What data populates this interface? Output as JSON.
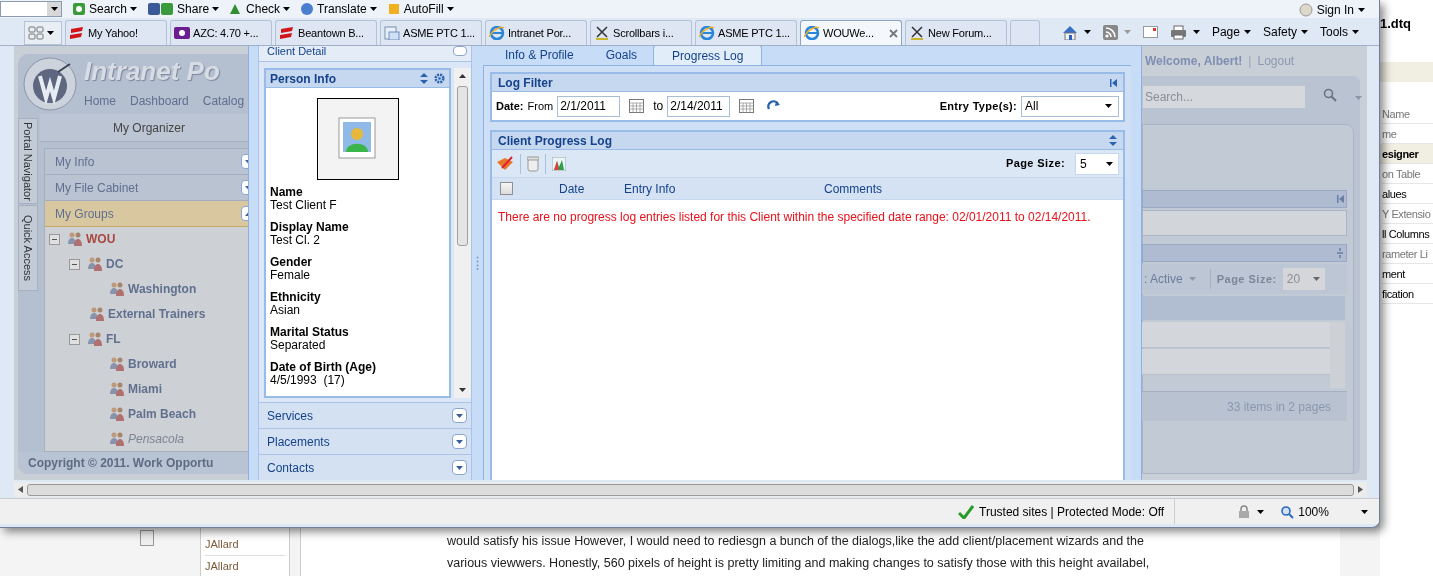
{
  "browser": {
    "toolbar": [
      {
        "label": "Search",
        "kind": "search"
      },
      {
        "label": "Share",
        "kind": "share"
      },
      {
        "label": "Check",
        "kind": "check"
      },
      {
        "label": "Translate",
        "kind": "translate"
      },
      {
        "label": "AutoFill",
        "kind": "autofill"
      }
    ],
    "sign_in": "Sign In",
    "tabs": [
      {
        "label": "My Yahoo!",
        "kind": "espn",
        "selected": false
      },
      {
        "label": "AZC: 4.70 +...",
        "kind": "yahoo",
        "selected": false
      },
      {
        "label": "Beantown B...",
        "kind": "espn",
        "selected": false
      },
      {
        "label": "ASME PTC 1...",
        "kind": "page",
        "selected": false
      },
      {
        "label": "Intranet Por...",
        "kind": "ie",
        "selected": false
      },
      {
        "label": "Scrollbars i...",
        "kind": "forum",
        "selected": false
      },
      {
        "label": "ASME PTC 1...",
        "kind": "ie",
        "selected": false
      },
      {
        "label": "WOUWe...",
        "kind": "ie",
        "selected": true
      },
      {
        "label": "New Forum...",
        "kind": "forum",
        "selected": false
      }
    ],
    "command_bar": [
      "Page",
      "Safety",
      "Tools"
    ],
    "status": {
      "zone": "Trusted sites | Protected Mode: Off",
      "zoom": "100%"
    }
  },
  "page": {
    "logo_title": "Intranet Po",
    "nav": [
      "Home",
      "Dashboard",
      "Catalog"
    ],
    "side_tabs": [
      "Portal Navigator",
      "Quick Access"
    ],
    "organizer_title": "My Organizer",
    "accordion": [
      {
        "label": "My Info",
        "expanded": false
      },
      {
        "label": "My File Cabinet",
        "expanded": false
      },
      {
        "label": "My Groups",
        "expanded": true
      }
    ],
    "tree": [
      {
        "label": "WOU",
        "selected": true,
        "disabled": false,
        "children": [
          {
            "label": "DC",
            "selected": false,
            "disabled": false,
            "children": [
              {
                "label": "Washington",
                "selected": false,
                "disabled": false
              }
            ]
          },
          {
            "label": "External Trainers",
            "selected": false,
            "disabled": false
          },
          {
            "label": "FL",
            "selected": false,
            "disabled": false,
            "children": [
              {
                "label": "Broward",
                "selected": false,
                "disabled": false
              },
              {
                "label": "Miami",
                "selected": false,
                "disabled": false
              },
              {
                "label": "Palm Beach",
                "selected": false,
                "disabled": false
              },
              {
                "label": "Pensacola",
                "selected": false,
                "disabled": true
              }
            ]
          }
        ]
      }
    ],
    "copyright": "Copyright © 2011. Work Opportu",
    "welcome": "Welcome, Albert!",
    "separator": "|",
    "logout": "Logout",
    "search": {
      "placeholder": "Search..."
    },
    "grid": {
      "filter": ": Active",
      "page_size_label": "Page Size:",
      "page_size": "20",
      "pager": "33 items in 2 pages"
    }
  },
  "dialog": {
    "header": "Client Detail",
    "person_info": {
      "title": "Person Info",
      "fields": [
        {
          "label": "Name",
          "value": "Test Client F"
        },
        {
          "label": "Display Name",
          "value": "Test Cl. 2"
        },
        {
          "label": "Gender",
          "value": "Female"
        },
        {
          "label": "Ethnicity",
          "value": "Asian"
        },
        {
          "label": "Marital Status",
          "value": "Separated"
        },
        {
          "label": "Date of Birth (Age)",
          "value": "4/5/1993  (17)"
        }
      ]
    },
    "sections": [
      {
        "label": "Services",
        "expanded": false
      },
      {
        "label": "Placements",
        "expanded": false
      },
      {
        "label": "Contacts",
        "expanded": false
      }
    ],
    "tabs": [
      {
        "label": "Info & Profile",
        "selected": false
      },
      {
        "label": "Goals",
        "selected": false
      },
      {
        "label": "Progress Log",
        "selected": true
      }
    ],
    "log_filter": {
      "title": "Log Filter",
      "date_label": "Date:",
      "from_label": "From",
      "from": "2/1/2011",
      "to_label": "to",
      "to": "2/14/2011",
      "entry_type_label": "Entry Type(s):",
      "entry_type": "All"
    },
    "progress_log": {
      "title": "Client Progress Log",
      "page_size_label": "Page Size:",
      "page_size": "5",
      "select_all": {
        "checked": false
      },
      "columns": [
        "Date",
        "Entry Info",
        "Comments"
      ],
      "empty_message": "There are no progress log entries listed for this Client within the specified date range: 02/01/2011 to 02/14/2011."
    }
  },
  "background": {
    "file": "1.dtq",
    "list": [
      {
        "label": "Name",
        "kind": "item",
        "disabled": true
      },
      {
        "label": "me",
        "kind": "item",
        "disabled": true
      },
      {
        "label": "esigner",
        "kind": "header",
        "disabled": false
      },
      {
        "label": "on Table",
        "kind": "item",
        "disabled": true
      },
      {
        "label": "alues",
        "kind": "item",
        "disabled": false
      },
      {
        "label": "Y Extensio",
        "kind": "item",
        "disabled": true
      },
      {
        "label": "ll Columns",
        "kind": "item",
        "disabled": false
      },
      {
        "label": "rameter Li",
        "kind": "item",
        "disabled": true
      },
      {
        "label": "ment",
        "kind": "item",
        "disabled": false
      },
      {
        "label": "fication",
        "kind": "item",
        "disabled": false
      }
    ],
    "rows": [
      "JAllard",
      "JAllard"
    ],
    "text": [
      "would satisfy his issue However, I would need to rediesgn a bunch of the dialogs,like the add client/placement wizards and the",
      "various viewwers. Honestly, 560 pixels of height is pretty limiting and making changes to satisfy those with this height availabel,"
    ]
  }
}
